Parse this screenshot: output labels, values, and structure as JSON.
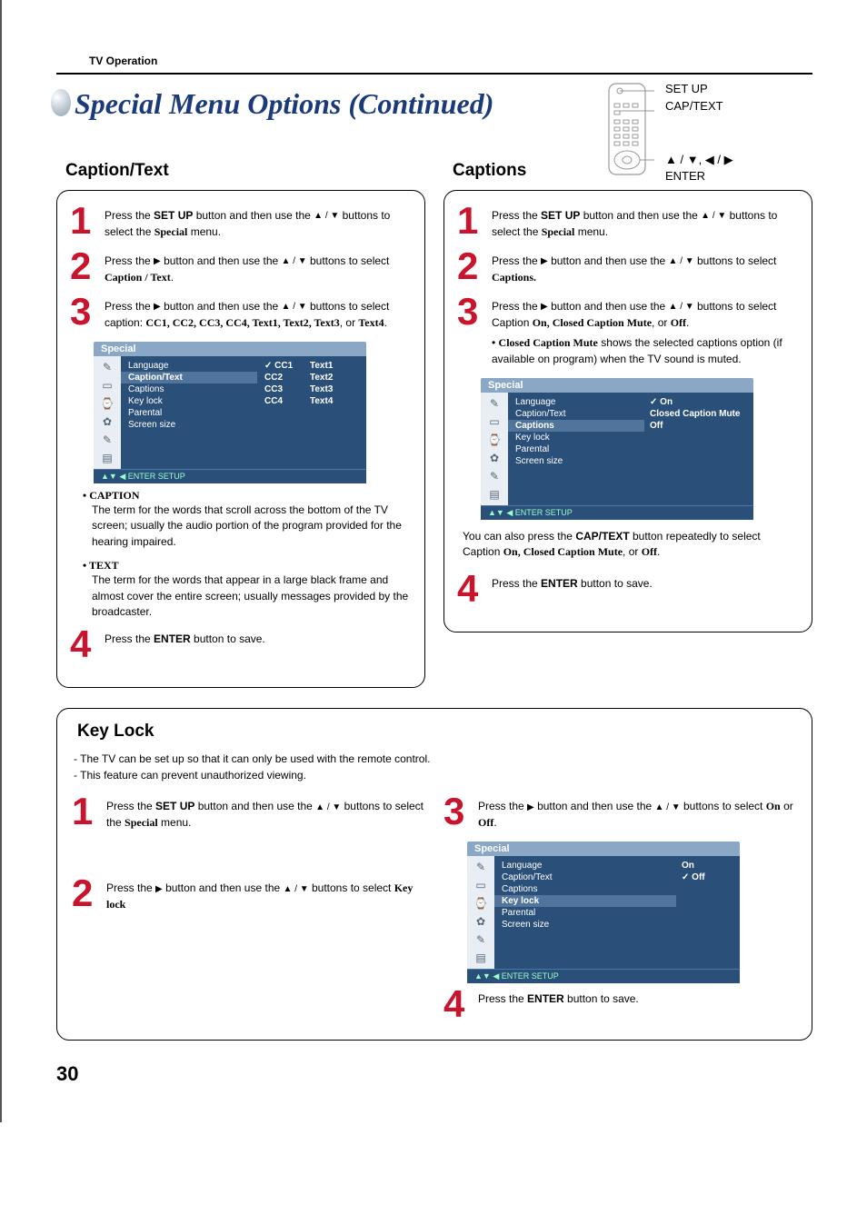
{
  "header": {
    "section": "TV Operation",
    "title": "Special Menu Options (Continued)"
  },
  "remote": {
    "label1": "SET UP",
    "label2": "CAP/TEXT",
    "arrows": "▲ / ▼, ◀ / ▶",
    "enter": "ENTER"
  },
  "captionText": {
    "title": "Caption/Text",
    "steps": {
      "s1": {
        "num": "1",
        "pre": "Press the ",
        "b1": "SET UP",
        "mid": " button and then use the ",
        "arrows": "▲ / ▼",
        "post": " buttons to select the ",
        "b2": "Special",
        "end": " menu."
      },
      "s2": {
        "num": "2",
        "pre": "Press the ",
        "arrowR": "▶",
        "mid": " button and then use the ",
        "arrows": "▲ / ▼",
        "post": " buttons to select ",
        "b1": "Caption / Text",
        "end": "."
      },
      "s3": {
        "num": "3",
        "pre": "Press the ",
        "arrowR": "▶",
        "mid": " button and then use the ",
        "arrows": "▲ / ▼",
        "post": " buttons to select caption: ",
        "list": "CC1, CC2, CC3, CC4, Text1, Text2, Text3",
        "or": ", or ",
        "last": "Text4",
        "end": "."
      },
      "s4": {
        "num": "4",
        "pre": "Press the ",
        "b1": "ENTER",
        "post": " button to save."
      }
    },
    "def": {
      "caption": {
        "dt": "• CAPTION",
        "dd": "The term for the words that scroll across the bottom of the TV screen; usually the audio portion of the program provided for the hearing impaired."
      },
      "text": {
        "dt": "• TEXT",
        "dd": "The term for the words that appear in a large black frame and almost cover the entire screen; usually messages provided by the broadcaster."
      }
    },
    "osd": {
      "top": "Special",
      "menu": [
        "Language",
        "Caption/Text",
        "Captions",
        "Key lock",
        "Parental",
        "Screen size"
      ],
      "highlight": 1,
      "optsL": [
        "CC1",
        "CC2",
        "CC3",
        "CC4"
      ],
      "checkedL": 0,
      "optsR": [
        "Text1",
        "Text2",
        "Text3",
        "Text4"
      ],
      "foot": "▲▼  ◀ ENTER   SETUP"
    }
  },
  "captions": {
    "title": "Captions",
    "steps": {
      "s1": {
        "num": "1",
        "pre": "Press the ",
        "b1": "SET UP",
        "mid": " button and then use the ",
        "arrows": "▲ / ▼",
        "post": " buttons to select the ",
        "b2": "Special",
        "end": " menu."
      },
      "s2": {
        "num": "2",
        "pre": "Press the ",
        "arrowR": "▶",
        "mid": " button and then use the ",
        "arrows": "▲ / ▼",
        "post": " buttons to select ",
        "b1": "Captions.",
        "end": ""
      },
      "s3": {
        "num": "3",
        "pre": "Press the ",
        "arrowR": "▶",
        "mid": " button and then use the ",
        "arrows": "▲ / ▼",
        "post": " buttons to select Caption ",
        "opts": "On, Closed Caption Mute",
        "or": ", or ",
        "last": "Off",
        "end": ".",
        "bullet": "• ",
        "bulb": "Closed Caption Mute",
        "bulrest": " shows the selected captions option (if available on program) when the TV sound is muted."
      },
      "s4": {
        "num": "4",
        "pre": "Press the ",
        "b1": "ENTER",
        "post": " button to save."
      }
    },
    "note": {
      "pre": "You can also press the ",
      "b1": "CAP/TEXT",
      "mid": " button repeatedly to select Caption ",
      "opts": "On, Closed Caption Mute",
      "or": ", or ",
      "last": "Off",
      "end": "."
    },
    "osd": {
      "top": "Special",
      "menu": [
        "Language",
        "Caption/Text",
        "Captions",
        "Key lock",
        "Parental",
        "Screen size"
      ],
      "highlight": 2,
      "opts": [
        "On",
        "Closed Caption Mute",
        "Off"
      ],
      "checked": 0,
      "foot": "▲▼  ◀ ENTER   SETUP"
    }
  },
  "keylock": {
    "title": "Key Lock",
    "intro1": "The TV can be set up so that it can only be used with the remote control.",
    "intro2": "This feature can prevent unauthorized viewing.",
    "steps": {
      "s1": {
        "num": "1",
        "pre": "Press the ",
        "b1": "SET UP",
        "mid": " button and then use the ",
        "arrows": "▲ / ▼",
        "post": " buttons to select the ",
        "b2": "Special",
        "end": " menu."
      },
      "s2": {
        "num": "2",
        "pre": "Press the ",
        "arrowR": "▶",
        "mid": " button and then use the ",
        "arrows": "▲ / ▼",
        "post": " buttons to select ",
        "b1": "Key lock",
        "end": ""
      },
      "s3": {
        "num": "3",
        "pre": "Press the ",
        "arrowR": "▶",
        "mid": " button and then use the ",
        "arrows": "▲ / ▼",
        "post": " buttons to select ",
        "b1": "On",
        "or": " or ",
        "b2": "Off",
        "end": "."
      },
      "s4": {
        "num": "4",
        "pre": "Press the ",
        "b1": "ENTER",
        "post": " button to save."
      }
    },
    "osd": {
      "top": "Special",
      "menu": [
        "Language",
        "Caption/Text",
        "Captions",
        "Key lock",
        "Parental",
        "Screen size"
      ],
      "highlight": 3,
      "opts": [
        "On",
        "Off"
      ],
      "checked": 1,
      "foot": "▲▼  ◀ ENTER   SETUP"
    }
  },
  "pagenum": "30"
}
